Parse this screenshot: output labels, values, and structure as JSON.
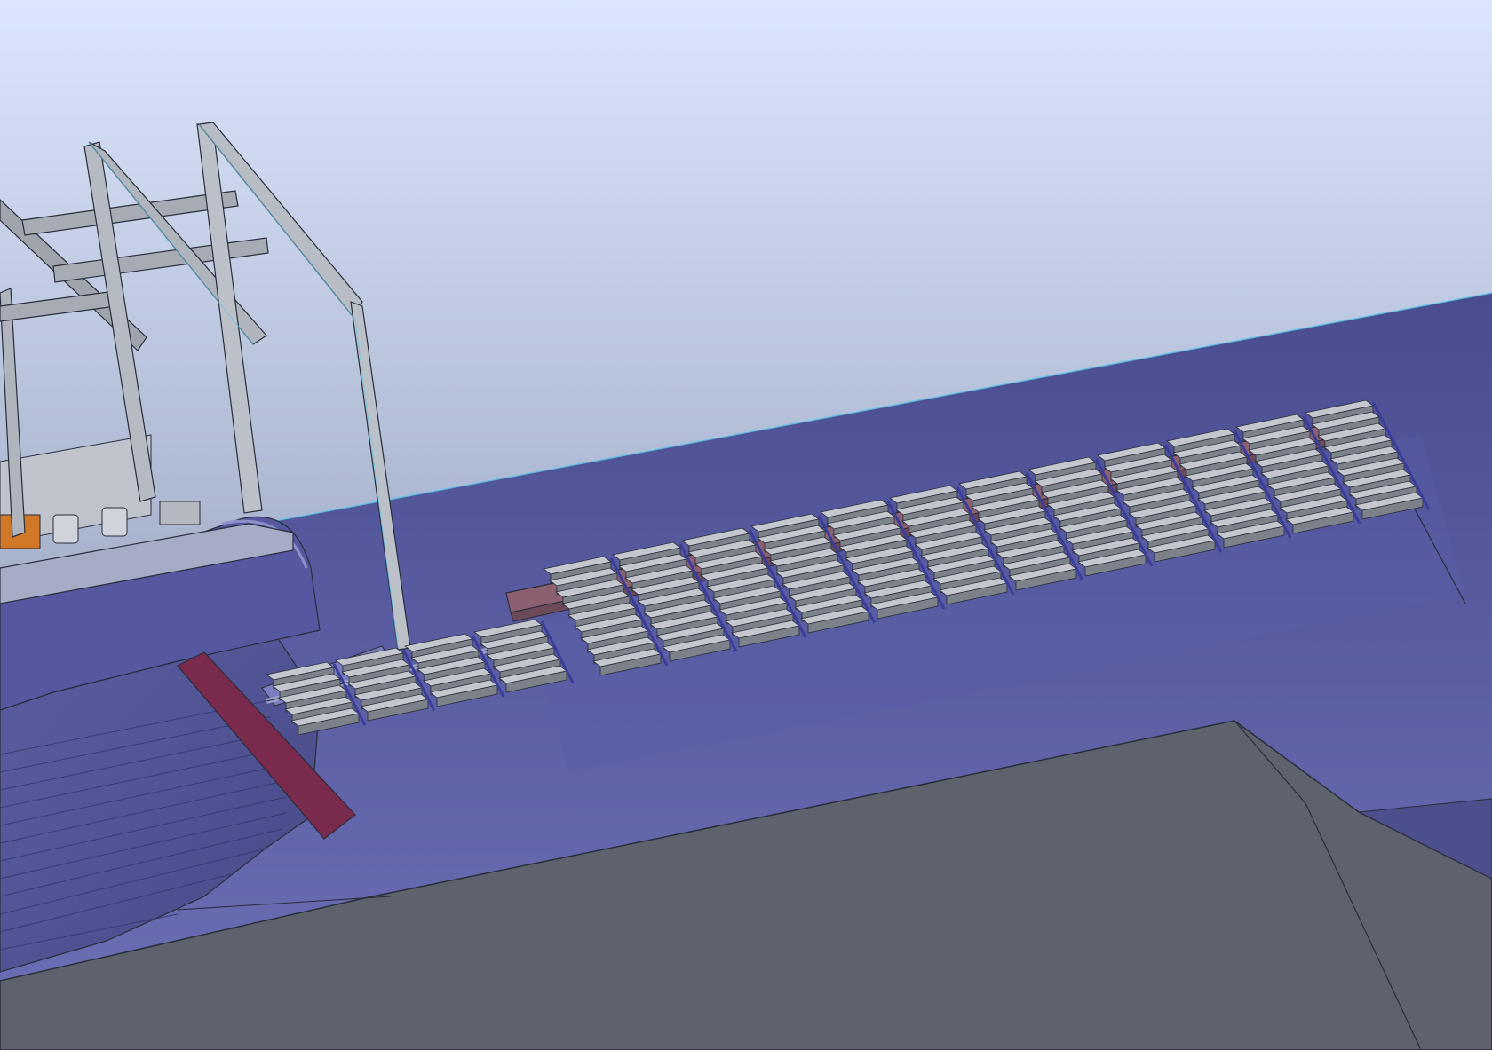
{
  "viewport": {
    "kind": "3d-cad-model-viewport",
    "visible_text": []
  },
  "colors": {
    "sky_top": "#dbe6fc",
    "sky_bottom": "#7c86a4",
    "water": "#4d4f93",
    "water_deep": "#6a6eb2",
    "seabed": "#5e626d",
    "steel": "#b4b8c0",
    "steel_dark": "#7d818a",
    "timber": "#8c6070",
    "edge": "#2a2d3a",
    "highlight": "#5fc8ea",
    "accent_orange": "#d07828",
    "fender_red": "#7a2a4c"
  },
  "icons": [
    "none"
  ]
}
